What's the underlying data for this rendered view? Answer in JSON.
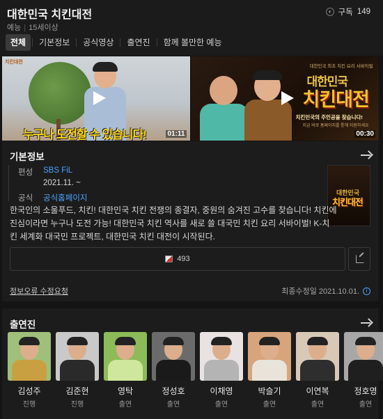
{
  "header": {
    "title": "대한민국 치킨대전",
    "genre": "예능",
    "rating": "15세이상",
    "subscribe_label": "구독",
    "subscribe_count": "149"
  },
  "tabs": [
    {
      "label": "전체",
      "active": true
    },
    {
      "label": "기본정보"
    },
    {
      "label": "공식영상"
    },
    {
      "label": "출연진"
    },
    {
      "label": "함께 볼만한 예능"
    }
  ],
  "videos": [
    {
      "caption": "누구나 도전할 수 있습니다!",
      "corner_logo": "치킨대전",
      "duration": "01:11"
    },
    {
      "top_line": "대한민국 최초 치킨 요리 서바이벌",
      "title_small": "대한민국",
      "title_big": "치킨대전",
      "slogan": "치킨민국의 주인공을 찾습니다!",
      "sub": "지금 바로 홈페이지를 통해 지원하세요",
      "duration": "00:30"
    }
  ],
  "basic_info": {
    "section_title": "기본정보",
    "fields": [
      {
        "label": "편성",
        "value": "SBS FiL",
        "link": true
      },
      {
        "label": "",
        "value": "2021.11. ~",
        "link": false
      },
      {
        "label": "공식",
        "value": "공식홈페이지",
        "link": true
      }
    ],
    "poster_text_top": "대한민국",
    "poster_text_bottom": "치킨대전",
    "description": "한국인의 소울푸드, 치킨! 대한민국 치킨 전쟁의 종결자, 중원의 숨겨진 고수를 찾습니다! 치킨에 진심이라면 누구나 도전 가능! 대한민국 치킨 역사를 새로 쓸 대국민 치킨 요리 서바이벌! K-치킨 세계화 대국민 프로젝트, 대한민국 치킨 대전이 시작된다.",
    "like_count": "493",
    "report_link": "정보오류 수정요청",
    "last_modified": "최종수정일 2021.10.01."
  },
  "cast": {
    "section_title": "출연진",
    "members": [
      {
        "name": "김성주",
        "role": "진행",
        "bg": "#9fbf7a",
        "body": "#c9a041"
      },
      {
        "name": "김준현",
        "role": "진행",
        "bg": "#c9c9c9",
        "body": "#2a2a2a"
      },
      {
        "name": "영탁",
        "role": "출연",
        "bg": "#8dbb59",
        "body": "#cfe79c"
      },
      {
        "name": "정성호",
        "role": "출연",
        "bg": "#6b6b6b",
        "body": "#1a1a1a"
      },
      {
        "name": "이채영",
        "role": "출연",
        "bg": "#e8e2e2",
        "body": "#b4b4b4"
      },
      {
        "name": "박슬기",
        "role": "출연",
        "bg": "#d8a47c",
        "body": "#e9e4da"
      },
      {
        "name": "이연복",
        "role": "출연",
        "bg": "#d8c9b6",
        "body": "#2e2e2e"
      },
      {
        "name": "정호영",
        "role": "출연",
        "bg": "#a7a7a7",
        "body": "#1f1f1f"
      }
    ]
  }
}
